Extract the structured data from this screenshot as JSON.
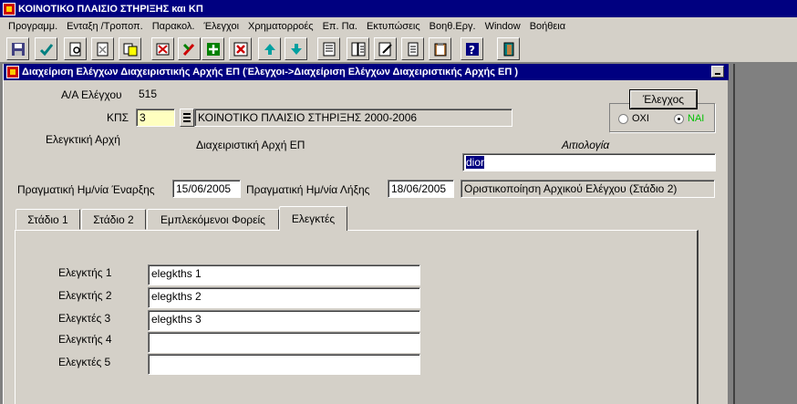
{
  "app_title": "ΚΟΙΝΟΤΙΚΟ ΠΛΑΙΣΙΟ ΣΤΗΡΙΞΗΣ και ΚΠ",
  "menu": [
    "Προγραμμ.",
    "Ενταξη /Τροποπ.",
    "Παρακολ.",
    "Έλεγχοι",
    "Χρηματορροές",
    "Επ. Πα.",
    "Εκτυπώσεις",
    "Βοηθ.Εργ.",
    "Window",
    "Βοήθεια"
  ],
  "toolbar_icons": [
    "save-icon",
    "accept-icon",
    "query-icon",
    "clear-icon",
    "copy-icon",
    "delete-record-icon",
    "edit-icon",
    "insert-record-icon",
    "remove-record-icon",
    "previous-record-icon",
    "next-record-icon",
    "list-icon",
    "details-icon",
    "edit-document-icon",
    "notes-icon",
    "clipboard-icon",
    "help-icon",
    "exit-icon"
  ],
  "window_title": "Διαχείριση Ελέγχων Διαχειριστικής Αρχής ΕΠ (Έλεγχοι->Διαχείριση Ελέγχων Διαχειριστικής Αρχής ΕΠ )",
  "form": {
    "aa_label": "Α/Α Ελέγχου",
    "aa_value": "515",
    "kps_label": "ΚΠΣ",
    "kps_value": "3",
    "kps_desc": "ΚΟΙΝΟΤΙΚΟ ΠΛΑΙΣΙΟ ΣΤΗΡΙΞΗΣ 2000-2006",
    "authority_label": "Ελεγκτική Αρχή",
    "authority_value": "Διαχειριστική Αρχή ΕΠ",
    "reason_label": "Αιτιολογία",
    "reason_value": "dior",
    "start_label": "Πραγματική Ημ/νία Έναρξης",
    "start_value": "15/06/2005",
    "end_label": "Πραγματική Ημ/νία Λήξης",
    "end_value": "18/06/2005",
    "status_value": "Οριστικοποίηση Αρχικού Ελέγχου (Στάδιο 2)"
  },
  "check_group": {
    "button_label": "Έλεγχος",
    "option_no": "ΟΧΙ",
    "option_yes": "ΝΑΙ",
    "selected": "ΝΑΙ",
    "yes_color": "#00c000"
  },
  "tabs": [
    "Στάδιο 1",
    "Στάδιο 2",
    "Εμπλεκόμενοι Φορείς",
    "Ελεγκτές"
  ],
  "active_tab": "Ελεγκτές",
  "auditors": [
    {
      "label": "Ελεγκτής 1",
      "value": "elegkths 1"
    },
    {
      "label": "Ελεγκτής 2",
      "value": "elegkths 2"
    },
    {
      "label": "Ελεγκτές 3",
      "value": "elegkths 3"
    },
    {
      "label": "Ελεγκτής 4",
      "value": ""
    },
    {
      "label": "Ελεγκτές 5",
      "value": ""
    }
  ]
}
